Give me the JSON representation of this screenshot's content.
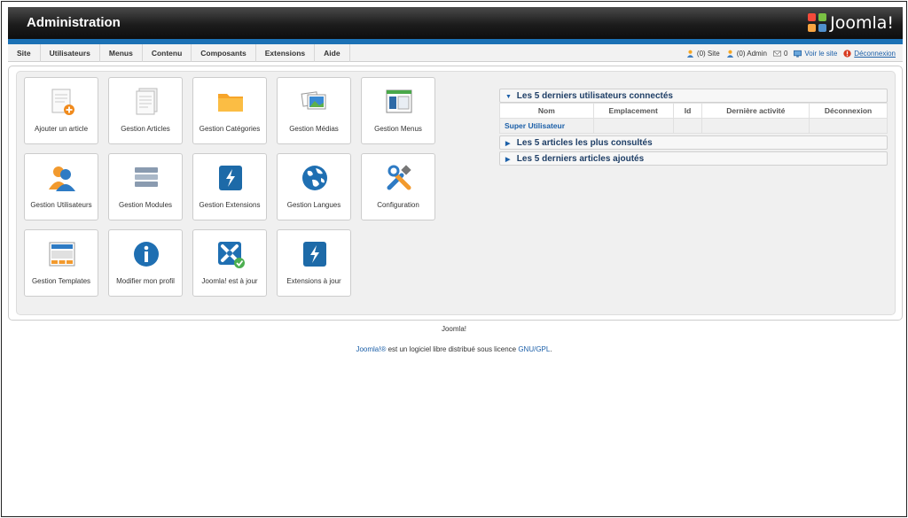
{
  "header": {
    "title": "Administration",
    "logo_text": "Joomla!"
  },
  "menu": {
    "items": [
      "Site",
      "Utilisateurs",
      "Menus",
      "Contenu",
      "Composants",
      "Extensions",
      "Aide"
    ]
  },
  "status": {
    "site_visitors": "(0) Site",
    "admin_visitors": "(0) Admin",
    "messages": "0",
    "view_site": "Voir le site",
    "logout": "Déconnexion"
  },
  "cpanel": {
    "tiles": [
      {
        "label": "Ajouter un article",
        "icon": "add-article-icon"
      },
      {
        "label": "Gestion Articles",
        "icon": "articles-icon"
      },
      {
        "label": "Gestion Catégories",
        "icon": "folder-icon"
      },
      {
        "label": "Gestion Médias",
        "icon": "media-icon"
      },
      {
        "label": "Gestion Menus",
        "icon": "menu-manager-icon"
      },
      {
        "label": "Gestion Utilisateurs",
        "icon": "users-icon"
      },
      {
        "label": "Gestion Modules",
        "icon": "modules-icon"
      },
      {
        "label": "Gestion Extensions",
        "icon": "extensions-icon"
      },
      {
        "label": "Gestion Langues",
        "icon": "globe-icon"
      },
      {
        "label": "Configuration",
        "icon": "tools-icon"
      },
      {
        "label": "Gestion Templates",
        "icon": "template-icon"
      },
      {
        "label": "Modifier mon profil",
        "icon": "info-icon"
      },
      {
        "label": "Joomla! est à jour",
        "icon": "joomla-check-icon"
      },
      {
        "label": "Extensions à jour",
        "icon": "extensions-update-icon"
      }
    ]
  },
  "modules": {
    "logged": {
      "title": "Les 5 derniers utilisateurs connectés",
      "columns": [
        "Nom",
        "Emplacement",
        "Id",
        "Dernière activité",
        "Déconnexion"
      ],
      "rows": [
        [
          "Super Utilisateur",
          "",
          "",
          "",
          ""
        ]
      ]
    },
    "popular": {
      "title": "Les 5 articles les plus consultés"
    },
    "latest": {
      "title": "Les 5 derniers articles ajoutés"
    }
  },
  "footer": {
    "line1": "Joomla!",
    "brand_link": "Joomla!®",
    "middle": " est un logiciel libre distribué sous licence ",
    "license_link": "GNU/GPL",
    "end": "."
  },
  "colors": {
    "accent_blue": "#1b71b5",
    "link": "#1b5fa8",
    "heading": "#1e3e66",
    "header_dark": "#1c1c1c"
  }
}
